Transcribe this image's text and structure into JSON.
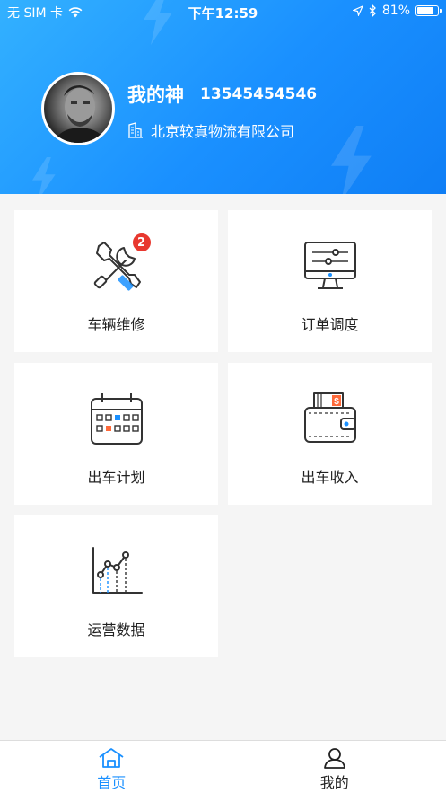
{
  "status_bar": {
    "carrier": "无 SIM 卡",
    "time": "下午12:59",
    "battery": "81%",
    "battery_level": 0.81
  },
  "profile": {
    "name": "我的神",
    "phone": "13545454546",
    "company": "北京较真物流有限公司"
  },
  "menu": [
    {
      "label": "车辆维修",
      "icon": "repair-tools-icon",
      "badge": "2"
    },
    {
      "label": "订单调度",
      "icon": "monitor-dispatch-icon"
    },
    {
      "label": "出车计划",
      "icon": "calendar-icon"
    },
    {
      "label": "出车收入",
      "icon": "wallet-icon"
    },
    {
      "label": "运营数据",
      "icon": "line-chart-icon"
    }
  ],
  "tabbar": {
    "active_color": "#1a90ff",
    "tabs": [
      {
        "label": "首页",
        "icon": "home-icon",
        "active": true
      },
      {
        "label": "我的",
        "icon": "person-icon",
        "active": false
      }
    ]
  }
}
